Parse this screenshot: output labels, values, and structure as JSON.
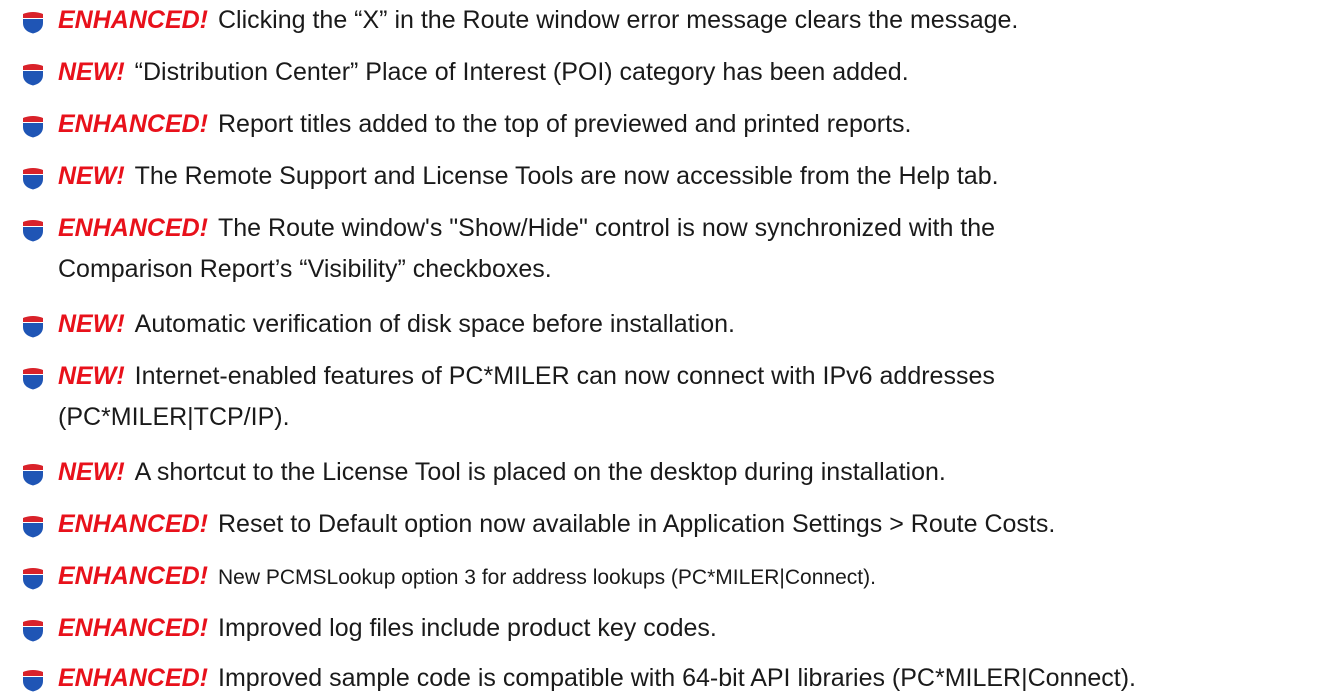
{
  "colors": {
    "tag": "#e8111b",
    "shield_blue": "#1f55b5",
    "shield_red": "#d9222a"
  },
  "icon": "interstate-shield-icon",
  "items": [
    {
      "tag": "ENHANCED!",
      "lines": [
        "Clicking the “X” in the Route window error message clears the message."
      ]
    },
    {
      "tag": "NEW!",
      "lines": [
        "“Distribution Center” Place of Interest (POI) category has been added."
      ]
    },
    {
      "tag": "ENHANCED!",
      "lines": [
        "Report titles added to the top of previewed and printed reports."
      ]
    },
    {
      "tag": "NEW!",
      "lines": [
        "The Remote Support and License Tools are now accessible from the Help tab."
      ]
    },
    {
      "tag": "ENHANCED!",
      "lines": [
        "The Route window's \"Show/Hide\" control is now synchronized with the",
        "Comparison Report’s “Visibility” checkboxes."
      ]
    },
    {
      "tag": "NEW!",
      "lines": [
        "Automatic verification of disk space before installation."
      ]
    },
    {
      "tag": "NEW!",
      "lines": [
        "Internet-enabled features of PC*MILER can now connect with IPv6 addresses",
        "(PC*MILER|TCP/IP)."
      ]
    },
    {
      "tag": "NEW!",
      "lines": [
        "A shortcut to the License Tool is placed on the desktop during installation."
      ]
    },
    {
      "tag": "ENHANCED!",
      "lines": [
        "Reset to Default option now available in Application Settings > Route Costs."
      ]
    },
    {
      "tag": "ENHANCED!",
      "lines": [
        "New PCMSLookup option 3 for address lookups (PC*MILER|Connect)."
      ]
    },
    {
      "tag": "ENHANCED!",
      "lines": [
        "Improved log files include product key codes."
      ]
    },
    {
      "tag": "ENHANCED!",
      "lines": [
        "Improved sample code is compatible with 64-bit API libraries (PC*MILER|Connect)."
      ]
    }
  ]
}
